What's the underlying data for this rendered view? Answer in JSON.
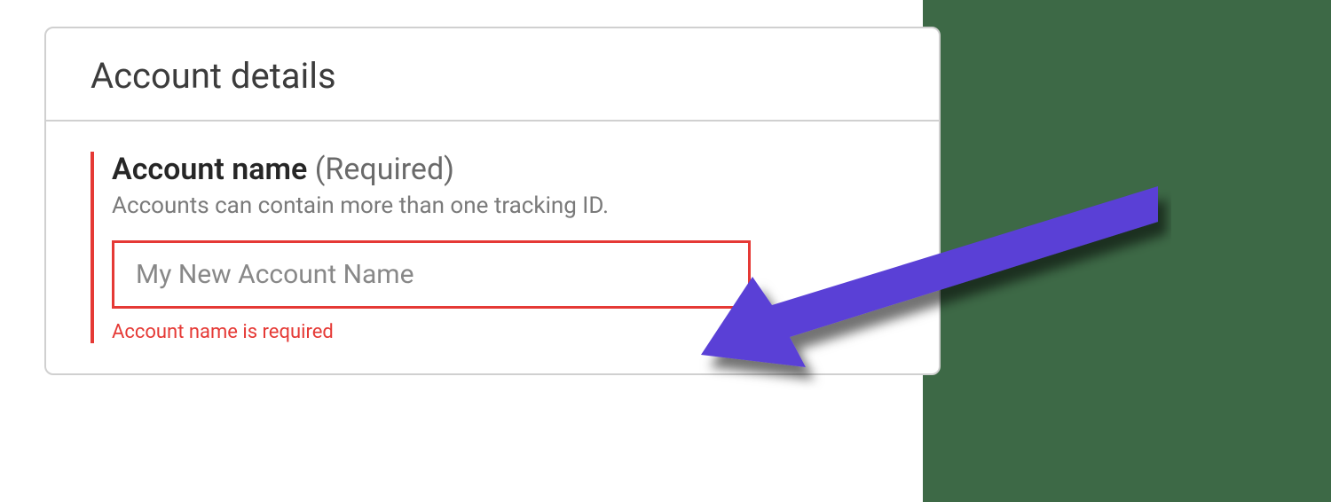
{
  "card": {
    "title": "Account details"
  },
  "field": {
    "label": "Account name",
    "required_suffix": "(Required)",
    "helper": "Accounts can contain more than one tracking ID.",
    "placeholder": "My New Account Name",
    "error": "Account name is required"
  },
  "colors": {
    "error": "#e53935",
    "arrow": "#5a3fd6",
    "sidebar": "#3d6946"
  }
}
